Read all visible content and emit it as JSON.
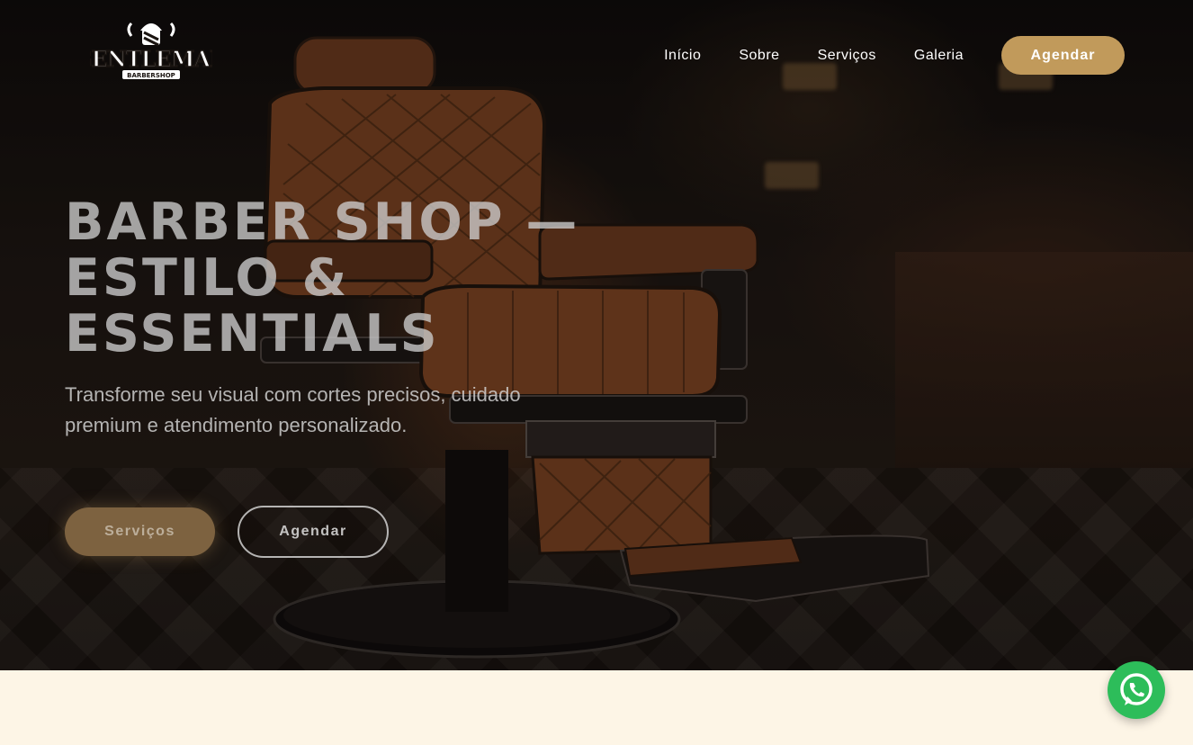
{
  "brand": {
    "name": "GENTLEMAN",
    "tagline": "BARBERSHOP"
  },
  "nav": {
    "items": [
      {
        "label": "Início"
      },
      {
        "label": "Sobre"
      },
      {
        "label": "Serviços"
      },
      {
        "label": "Galeria"
      }
    ],
    "cta_label": "Agendar"
  },
  "hero": {
    "title_line1": "BARBER SHOP —",
    "title_line2": "ESTILO &",
    "title_line3": "ESSENTIALS",
    "subtitle": "Transforme seu visual com cortes precisos, cuidado premium e atendimento personalizado.",
    "primary_button": "Serviços",
    "secondary_button": "Agendar"
  },
  "colors": {
    "accent": "#c19a5b",
    "section_bg": "#fdf5e6",
    "whatsapp": "#2dbd5a"
  },
  "icons": {
    "whatsapp": "whatsapp-icon",
    "logo": "barber-pole-logo"
  }
}
